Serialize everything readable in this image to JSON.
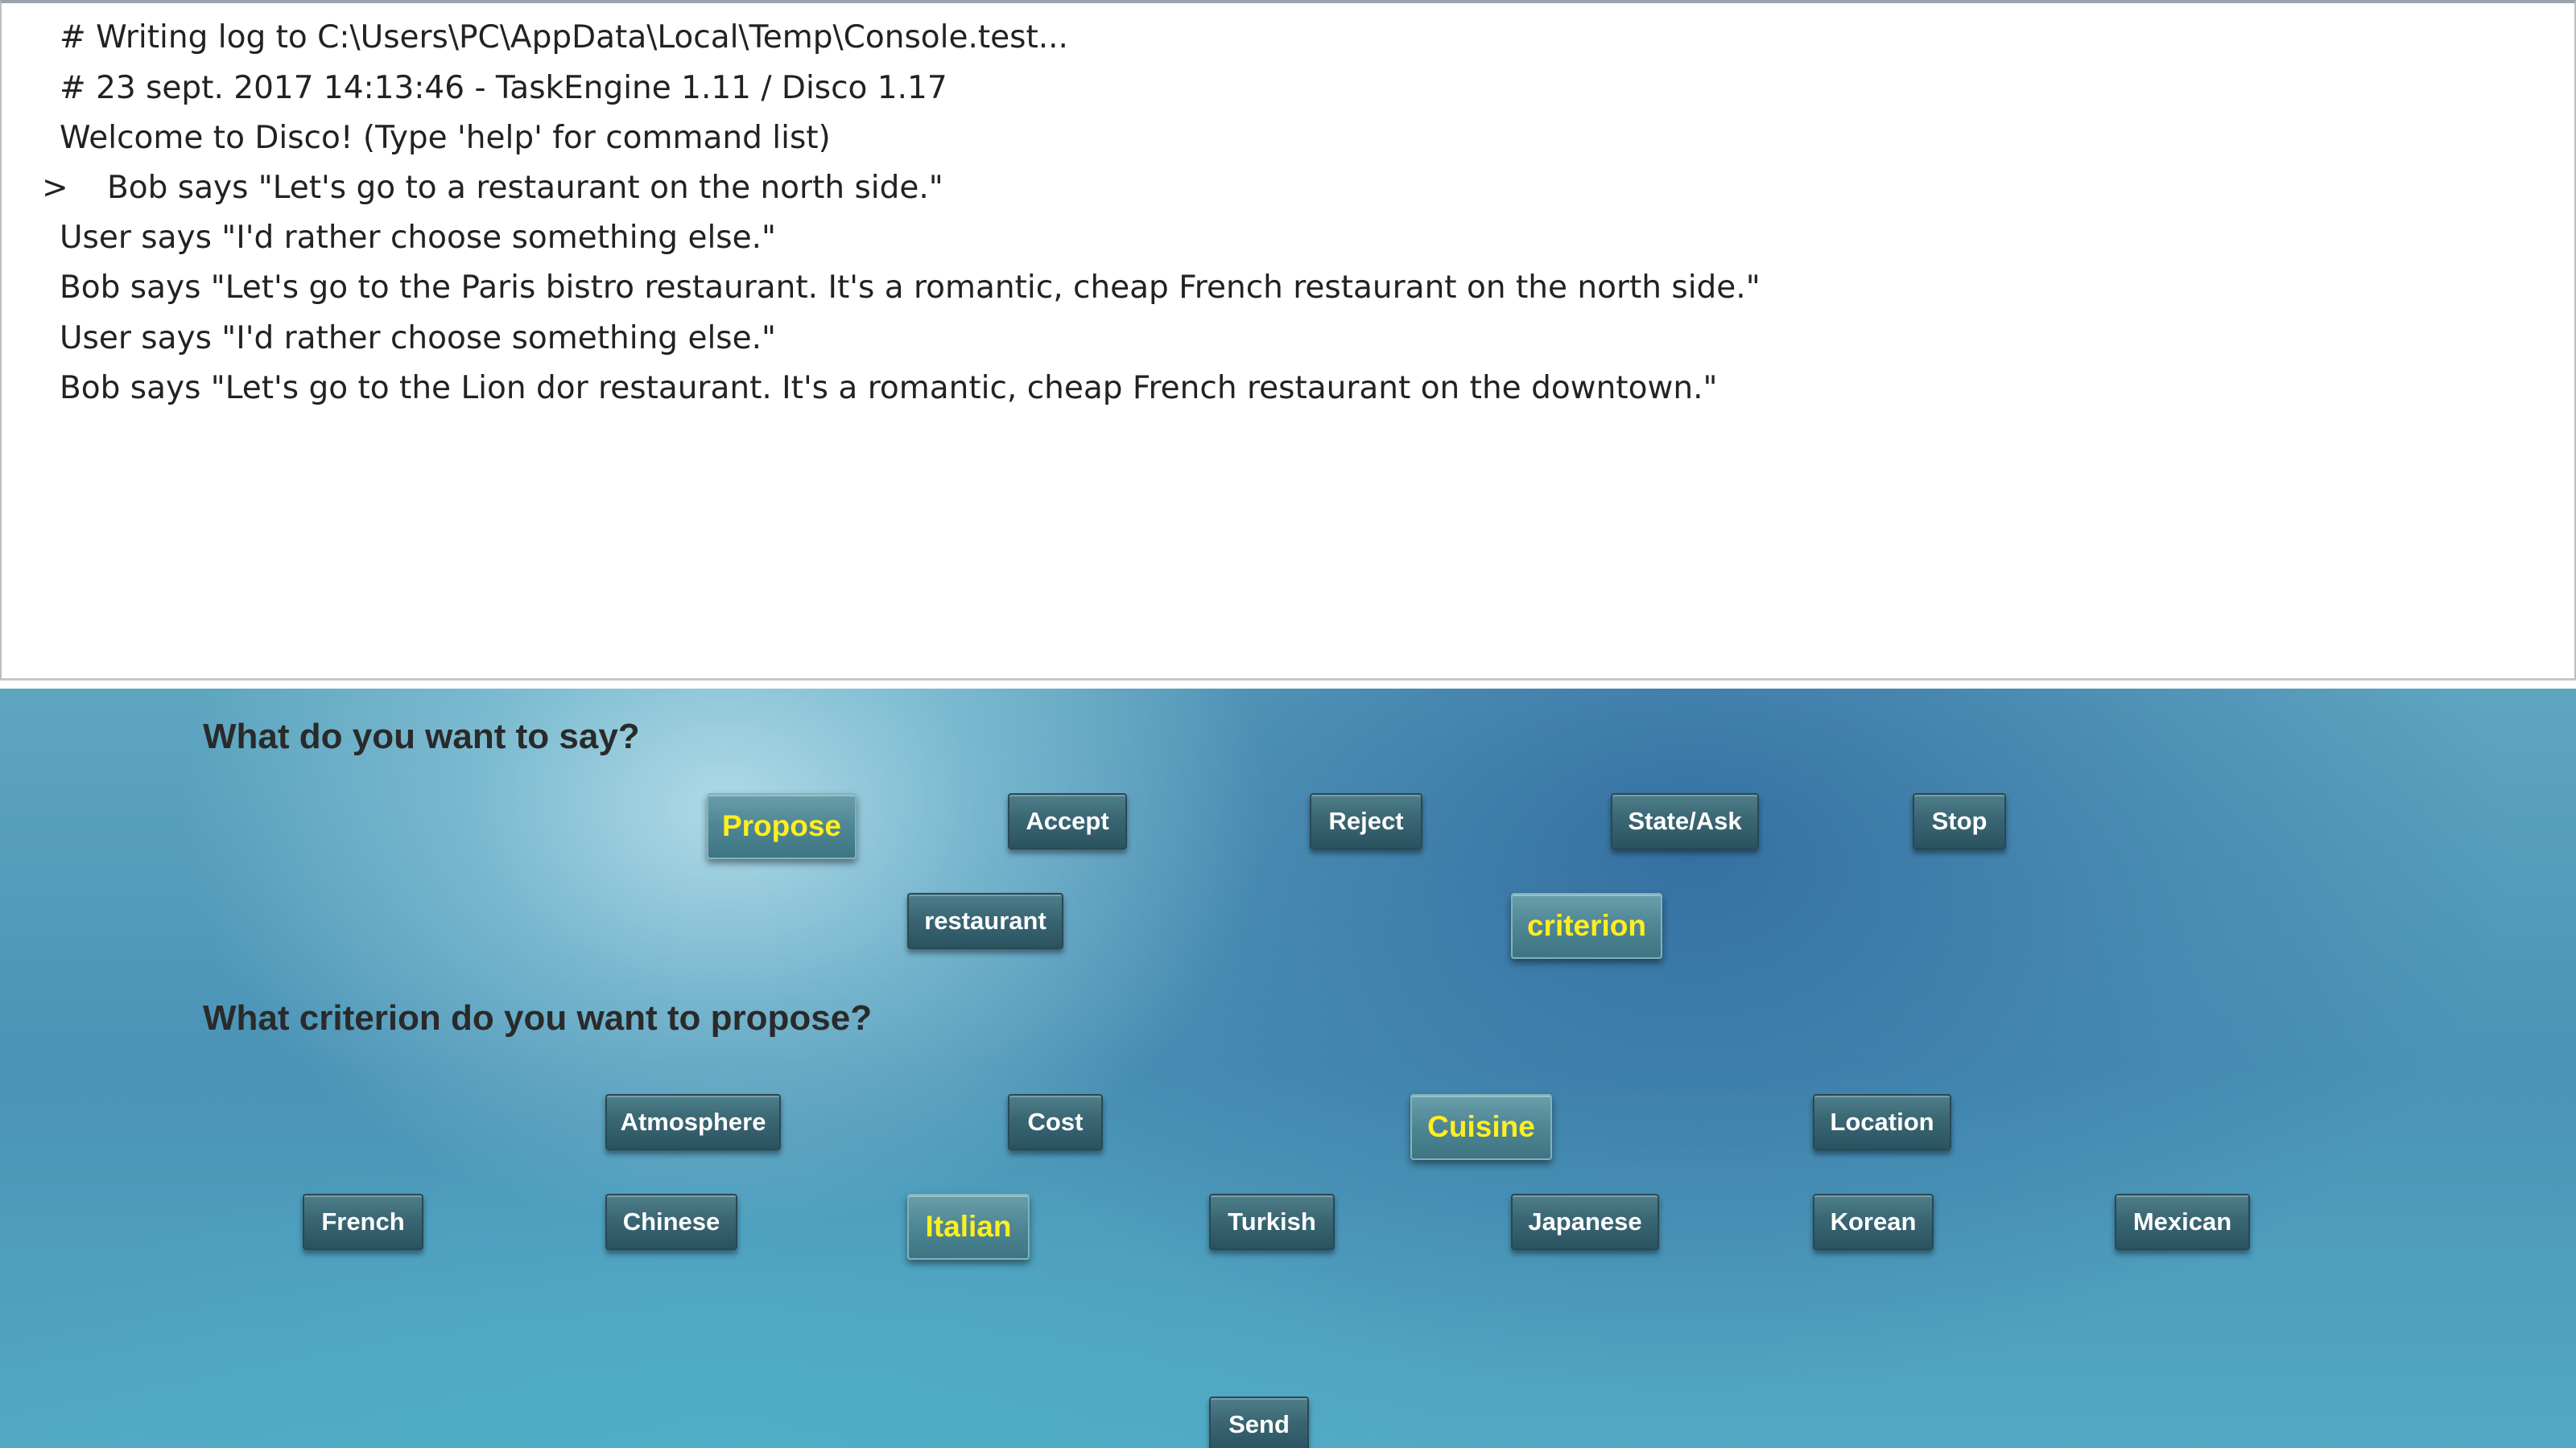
{
  "console": {
    "lines": [
      "# Writing log to C:\\Users\\PC\\AppData\\Local\\Temp\\Console.test...",
      "# 23 sept. 2017 14:13:46 - TaskEngine 1.11 / Disco 1.17",
      "Welcome to Disco! (Type 'help' for command list)",
      "Bob says \"Let's go to a restaurant on the north side.\"",
      "User says \"I'd rather choose something else.\"",
      "Bob says \"Let's go to the Paris bistro restaurant. It's a romantic, cheap French restaurant on the north side.\"",
      "User says \"I'd rather choose something else.\"",
      "Bob says \"Let's go to the Lion dor restaurant. It's a romantic, cheap French restaurant on the downtown.\""
    ],
    "prompt": ">"
  },
  "panel": {
    "question1": "What do you want to say?",
    "question2": "What criterion do you want to propose?",
    "utterance_types": [
      "Propose",
      "Accept",
      "Reject",
      "State/Ask",
      "Stop"
    ],
    "selected_utterance": "Propose",
    "propose_targets": [
      "restaurant",
      "criterion"
    ],
    "selected_target": "criterion",
    "criteria": [
      "Atmosphere",
      "Cost",
      "Cuisine",
      "Location"
    ],
    "selected_criterion": "Cuisine",
    "cuisines": [
      "French",
      "Chinese",
      "Italian",
      "Turkish",
      "Japanese",
      "Korean",
      "Mexican"
    ],
    "selected_cuisine": "Italian",
    "send_label": "Send",
    "highlight_color": "#ffef1f"
  }
}
